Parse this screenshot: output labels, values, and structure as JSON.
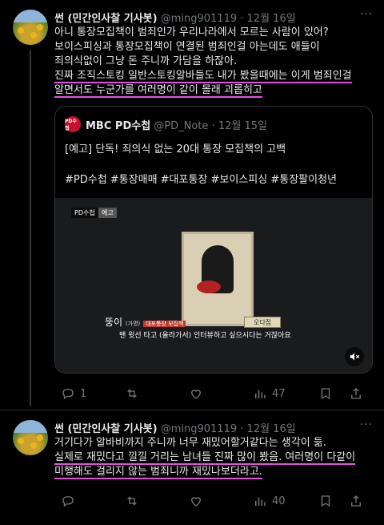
{
  "tweets": [
    {
      "name": "썬 (민간인사찰 기사봇)",
      "handle": "@ming901119",
      "dot": "·",
      "date": "12월 16일",
      "more": "···",
      "lines": [
        "아니 통장모집책이 범죄인가 우리나라에서 모르는 사람이 있어?",
        "보이스피싱과 통장모집책이 연결된 범죄인걸 아는데도 애들이",
        "죄의식없이 그냥 돈 주니까 가담을 하잖아.",
        "진짜 조직스토킹 일반스토킹알바들도 내가 봤을때에는 이게 범죄인걸",
        "알면서도 누군가를 여러명이 같이 몰래 괴롭히고"
      ],
      "quote": {
        "logo": "PD수첩",
        "name": "MBC PD수첩",
        "handle": "@PD_Note",
        "dot": "·",
        "date": "12월 15일",
        "line1": "[예고] 단독! 죄의식 없는 20대 통장 모집책의 고백",
        "line2": "#PD수첩 #통장매매 #대포통장 #보이스피싱 #통장팔이청년",
        "media": {
          "logo": "PD수첩",
          "tag": "예고",
          "plate": "오다접",
          "cap_name": "뚱이",
          "cap_small": "(가명)",
          "cap_role": "대포통장 모집책",
          "cap_line": "맨 윗선 타고 (올라가서) 인터뷰하고 싶으시다는 거잖아요"
        }
      },
      "actions": {
        "reply": "1",
        "retweet": "",
        "like": "",
        "views": "47"
      }
    },
    {
      "name": "썬 (민간인사찰 기사봇)",
      "handle": "@ming901119",
      "dot": "·",
      "date": "12월 16일",
      "more": "···",
      "lines": [
        "거기다가 알바비까지 주니까 너무 재밌어할거같다는 생각이 듦.",
        "실제로 재밌다고 낄낄 거리는 남녀들 진짜 많이 봤음. 여러명이 다같이",
        "미행해도 걸리지 않는 범죄니까 재밌나보더라고."
      ],
      "actions": {
        "reply": "",
        "retweet": "",
        "like": "",
        "views": "40"
      }
    }
  ],
  "colors": {
    "accent_underline": "#e64fe2",
    "muted": "#71767b",
    "text": "#e7e9ea"
  },
  "icons": [
    "reply-icon",
    "retweet-icon",
    "like-icon",
    "views-icon",
    "bookmark-icon",
    "share-icon",
    "mute-icon"
  ]
}
